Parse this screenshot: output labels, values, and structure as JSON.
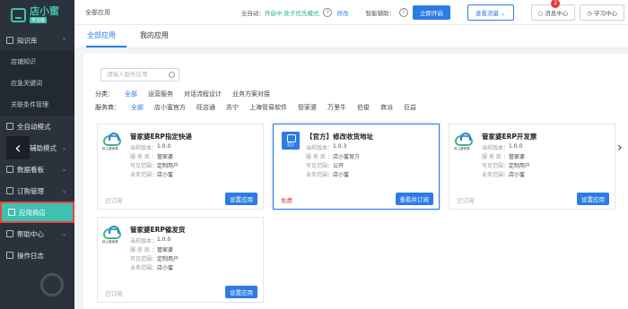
{
  "brand": {
    "name": "店小蜜",
    "tag": "专业版"
  },
  "sidebar": {
    "items": [
      {
        "label": "知识库",
        "arrow": "⌃"
      },
      {
        "label": "店铺知识"
      },
      {
        "label": "应急关键词"
      },
      {
        "label": "关联条件管理"
      },
      {
        "label": "全自动模式"
      },
      {
        "label": "辅助模式",
        "arrow": "⌄"
      },
      {
        "label": "数据看板",
        "arrow": "⌄"
      },
      {
        "label": "订购管理",
        "arrow": "⌄"
      },
      {
        "label": "应用商店"
      },
      {
        "label": "帮助中心",
        "arrow": "⌄"
      },
      {
        "label": "操作日志"
      }
    ]
  },
  "header": {
    "title": "全部应用",
    "auto_label": "全自动：",
    "auto_status": "开启中 处于优先模式",
    "modify": "修改",
    "assist_label": "智能辅助：",
    "open_now": "立即开启",
    "traffic": "查看流量",
    "messages": "消息中心",
    "message_count": "2",
    "learning": "学习中心"
  },
  "tabs": {
    "all": "全部应用",
    "mine": "我的应用"
  },
  "search": {
    "placeholder": "请输入服务应用"
  },
  "filters": {
    "category_label": "分类：",
    "categories": [
      "全部",
      "运营服务",
      "对话流程设计",
      "业务方案对接"
    ],
    "provider_label": "服务商：",
    "providers": [
      "全部",
      "店小蜜官方",
      "旺店通",
      "苏宁",
      "上海管易软件",
      "管家婆",
      "万里牛",
      "伯俊",
      "商派",
      "巨益"
    ]
  },
  "meta_keys": {
    "version": "当前版本",
    "provider": "服 务 商",
    "scope": "可见范围",
    "type": "业务范围"
  },
  "cards": [
    {
      "title": "管家婆ERP指定快递",
      "logo_caption": "网上管家婆",
      "version": "1.0.0",
      "provider": "管家婆",
      "scope": "定制用户",
      "type": "店小蜜",
      "status": "已订阅",
      "action": "设置应用"
    },
    {
      "title": "【官方】修改收货地址",
      "logo_caption": "官方",
      "version": "1.0.3",
      "provider": "店小蜜官方",
      "scope": "公开",
      "type": "店小蜜",
      "status": "免费",
      "action": "查看并订阅"
    },
    {
      "title": "管家婆ERP开发票",
      "logo_caption": "网上管家婆",
      "version": "1.0.0",
      "provider": "管家婆",
      "scope": "定制用户",
      "type": "店小蜜",
      "status": "已订阅",
      "action": "设置应用"
    },
    {
      "title": "管家婆ERP催发货",
      "logo_caption": "网上管家婆",
      "version": "1.0.0",
      "provider": "管家婆",
      "scope": "定制用户",
      "type": "店小蜜",
      "status": "已订阅",
      "action": "设置应用"
    }
  ]
}
